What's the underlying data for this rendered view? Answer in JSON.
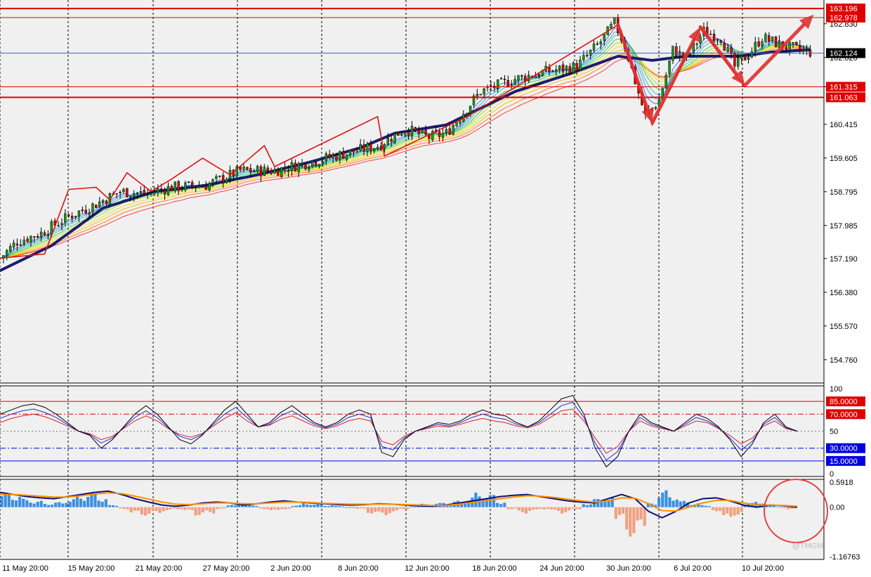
{
  "chart_data": [
    {
      "panel": "main",
      "type": "candlestick",
      "ylim": [
        154.2,
        163.4
      ],
      "y_ticks": [
        "162.830",
        "162.020",
        "161.315",
        "160.415",
        "159.605",
        "158.795",
        "157.985",
        "157.190",
        "156.380",
        "155.570",
        "154.760"
      ],
      "horizontal_lines": [
        {
          "value": 163.196,
          "label": "163.196",
          "color": "#e00000"
        },
        {
          "value": 162.978,
          "label": "162.978",
          "color": "#e00000"
        },
        {
          "value": 161.315,
          "label": "161.315",
          "color": "#e00000"
        },
        {
          "value": 161.063,
          "label": "161.063",
          "color": "#e00000"
        }
      ],
      "current_price": {
        "value": 162.124,
        "label": "162.124",
        "color": "#3a5fcd"
      },
      "close_path": [
        [
          0,
          157.2
        ],
        [
          5,
          157.6
        ],
        [
          12,
          157.8
        ],
        [
          20,
          158.2
        ],
        [
          28,
          158.5
        ],
        [
          35,
          158.8
        ],
        [
          42,
          158.75
        ],
        [
          50,
          158.9
        ],
        [
          60,
          158.95
        ],
        [
          70,
          159.3
        ],
        [
          80,
          159.3
        ],
        [
          90,
          159.5
        ],
        [
          100,
          159.7
        ],
        [
          110,
          159.9
        ],
        [
          118,
          160.3
        ],
        [
          125,
          160.1
        ],
        [
          130,
          160.2
        ],
        [
          140,
          161.2
        ],
        [
          150,
          161.5
        ],
        [
          160,
          161.7
        ],
        [
          168,
          161.8
        ],
        [
          175,
          162.4
        ],
        [
          179,
          162.85
        ],
        [
          182,
          162.3
        ],
        [
          188,
          160.6
        ],
        [
          192,
          161.0
        ],
        [
          196,
          162.2
        ],
        [
          200,
          162.0
        ],
        [
          205,
          162.65
        ],
        [
          210,
          162.5
        ],
        [
          214,
          161.8
        ],
        [
          218,
          162.1
        ],
        [
          222,
          162.5
        ],
        [
          228,
          162.3
        ],
        [
          235,
          162.15
        ]
      ],
      "slow_ma_path": [
        [
          0,
          156.9
        ],
        [
          15,
          157.5
        ],
        [
          30,
          158.4
        ],
        [
          45,
          158.8
        ],
        [
          60,
          158.95
        ],
        [
          75,
          159.2
        ],
        [
          90,
          159.5
        ],
        [
          105,
          159.85
        ],
        [
          115,
          160.2
        ],
        [
          130,
          160.4
        ],
        [
          140,
          160.8
        ],
        [
          150,
          161.2
        ],
        [
          165,
          161.6
        ],
        [
          180,
          162.05
        ],
        [
          190,
          161.95
        ],
        [
          200,
          162.05
        ],
        [
          215,
          162.05
        ],
        [
          225,
          162.15
        ],
        [
          235,
          162.2
        ]
      ],
      "zigzag": [
        [
          0,
          157.2
        ],
        [
          13,
          157.3
        ],
        [
          20,
          158.85
        ],
        [
          28,
          158.9
        ],
        [
          32,
          158.6
        ],
        [
          37,
          159.25
        ],
        [
          44,
          158.8
        ],
        [
          50,
          159.1
        ],
        [
          59,
          159.6
        ],
        [
          67,
          159.2
        ],
        [
          77,
          159.9
        ],
        [
          80,
          159.4
        ],
        [
          110,
          160.6
        ],
        [
          112,
          159.65
        ],
        [
          136,
          160.6
        ],
        [
          180,
          162.8
        ],
        [
          190,
          160.4
        ],
        [
          204,
          162.75
        ],
        [
          217,
          161.3
        ]
      ],
      "arrows": [
        {
          "from": [
            180,
            162.8
          ],
          "to": [
            190,
            160.45
          ]
        },
        {
          "from": [
            190,
            160.45
          ],
          "to": [
            204,
            162.75
          ]
        },
        {
          "from": [
            204,
            162.75
          ],
          "to": [
            217,
            161.35
          ]
        },
        {
          "from": [
            217,
            161.35
          ],
          "to": [
            237,
            163.05
          ]
        }
      ]
    },
    {
      "panel": "oscillator",
      "type": "line",
      "ylim": [
        0,
        100
      ],
      "y_ticks": [
        "100",
        "50",
        "0"
      ],
      "levels": [
        {
          "value": 85,
          "label": "85.0000",
          "color": "#e00000",
          "style": "solid"
        },
        {
          "value": 70,
          "label": "70.0000",
          "color": "#e00000",
          "style": "dashdot"
        },
        {
          "value": 50,
          "label": "",
          "color": "#808080",
          "style": "dotted"
        },
        {
          "value": 30,
          "label": "30.0000",
          "color": "#0000e0",
          "style": "dashdot"
        },
        {
          "value": 15,
          "label": "15.0000",
          "color": "#0000e0",
          "style": "solid"
        }
      ],
      "series": [
        {
          "color": "#000000",
          "values": [
            70,
            75,
            80,
            82,
            78,
            70,
            60,
            50,
            45,
            30,
            40,
            55,
            70,
            80,
            70,
            55,
            40,
            35,
            45,
            60,
            75,
            85,
            70,
            55,
            60,
            72,
            80,
            70,
            60,
            55,
            60,
            70,
            75,
            70,
            25,
            20,
            40,
            50,
            55,
            60,
            58,
            62,
            70,
            75,
            70,
            68,
            60,
            55,
            62,
            75,
            88,
            92,
            70,
            30,
            8,
            20,
            50,
            70,
            60,
            55,
            50,
            60,
            70,
            65,
            55,
            40,
            20,
            35,
            60,
            70,
            55,
            50
          ]
        },
        {
          "color": "#2030d0",
          "values": [
            65,
            70,
            74,
            76,
            72,
            66,
            58,
            50,
            46,
            36,
            42,
            54,
            66,
            74,
            66,
            54,
            44,
            40,
            46,
            58,
            70,
            78,
            66,
            55,
            58,
            68,
            74,
            66,
            58,
            54,
            58,
            66,
            70,
            66,
            32,
            28,
            42,
            50,
            54,
            58,
            56,
            60,
            66,
            70,
            66,
            64,
            58,
            55,
            60,
            70,
            80,
            84,
            66,
            36,
            16,
            26,
            50,
            66,
            58,
            54,
            50,
            58,
            66,
            62,
            54,
            42,
            28,
            38,
            58,
            66,
            54,
            50
          ]
        },
        {
          "color": "#e02020",
          "values": [
            60,
            65,
            68,
            70,
            67,
            62,
            56,
            50,
            47,
            40,
            44,
            53,
            62,
            68,
            62,
            53,
            46,
            43,
            47,
            56,
            65,
            72,
            62,
            55,
            57,
            64,
            68,
            62,
            56,
            53,
            56,
            62,
            65,
            62,
            38,
            34,
            44,
            50,
            53,
            56,
            55,
            58,
            62,
            65,
            62,
            60,
            56,
            54,
            58,
            66,
            74,
            76,
            62,
            42,
            24,
            32,
            50,
            62,
            56,
            53,
            50,
            56,
            62,
            60,
            53,
            45,
            35,
            42,
            56,
            62,
            53,
            50
          ]
        }
      ]
    },
    {
      "panel": "macd",
      "type": "bar+line",
      "ylim": [
        -1.16763,
        0.5918
      ],
      "y_ticks": [
        "0.5918",
        "0.00",
        "-1.16763"
      ],
      "histogram": [
        0.35,
        0.3,
        0.2,
        0.15,
        0.1,
        0.12,
        0.2,
        0.3,
        0.35,
        0.25,
        0.05,
        -0.05,
        -0.15,
        -0.2,
        -0.15,
        -0.1,
        -0.05,
        -0.1,
        -0.2,
        -0.15,
        -0.05,
        0.05,
        0.1,
        0.05,
        -0.05,
        -0.1,
        -0.05,
        0.05,
        0.1,
        0.08,
        0.05,
        0.03,
        0,
        -0.05,
        -0.15,
        -0.2,
        -0.15,
        -0.05,
        0.03,
        0.08,
        0.1,
        0.12,
        0.15,
        0.25,
        0.35,
        0.3,
        0.15,
        -0.05,
        -0.15,
        -0.1,
        -0.05,
        -0.1,
        -0.15,
        -0.05,
        0.1,
        0.2,
        0.25,
        -0.3,
        -0.7,
        -0.55,
        0.1,
        0.4,
        0.3,
        0.15,
        0.1,
        0.05,
        -0.1,
        -0.3,
        -0.2,
        0.1,
        0.15,
        0.05,
        -0.03,
        -0.05
      ],
      "series": [
        {
          "color": "#10107a",
          "values": [
            0.35,
            0.3,
            0.25,
            0.22,
            0.2,
            0.25,
            0.3,
            0.35,
            0.38,
            0.3,
            0.2,
            0.12,
            0.05,
            0.02,
            0.05,
            0.1,
            0.12,
            0.1,
            0.05,
            0.08,
            0.12,
            0.15,
            0.12,
            0.1,
            0.08,
            0.06,
            0.05,
            0.06,
            0.08,
            0.07,
            0.05,
            0.03,
            0.02,
            0.05,
            0.1,
            0.15,
            0.2,
            0.25,
            0.28,
            0.3,
            0.25,
            0.2,
            0.15,
            0.12,
            0.1,
            0.2,
            0.3,
            0.2,
            -0.1,
            -0.25,
            -0.1,
            0.1,
            0.2,
            0.22,
            0.15,
            0.05,
            0.0,
            0.05,
            0.03,
            0.0
          ]
        },
        {
          "color": "#ff9000",
          "values": [
            0.3,
            0.3,
            0.28,
            0.26,
            0.24,
            0.24,
            0.27,
            0.31,
            0.34,
            0.32,
            0.26,
            0.19,
            0.12,
            0.07,
            0.06,
            0.08,
            0.1,
            0.1,
            0.08,
            0.08,
            0.1,
            0.12,
            0.12,
            0.11,
            0.09,
            0.08,
            0.07,
            0.07,
            0.07,
            0.07,
            0.06,
            0.05,
            0.04,
            0.04,
            0.07,
            0.11,
            0.15,
            0.2,
            0.24,
            0.27,
            0.26,
            0.23,
            0.19,
            0.15,
            0.12,
            0.15,
            0.22,
            0.21,
            0.08,
            -0.08,
            -0.09,
            0.0,
            0.1,
            0.16,
            0.16,
            0.1,
            0.05,
            0.05,
            0.04,
            0.02
          ]
        }
      ]
    }
  ],
  "x_labels": [
    "11 May 20:00",
    "15 May 20:00",
    "21 May 20:00",
    "27 May 20:00",
    "2 Jun 20:00",
    "8 Jun 20:00",
    "12 Jun 20:00",
    "18 Jun 20:00",
    "24 Jun 20:00",
    "30 Jun 20:00",
    "6 Jul 20:00",
    "10 Jul 20:00"
  ],
  "watermark": "@TMGM",
  "colors": {
    "up": "#1a9a1a",
    "down": "#e00000",
    "grid": "#000000",
    "accent": "#e03030",
    "ma": "#1c1c6e"
  }
}
